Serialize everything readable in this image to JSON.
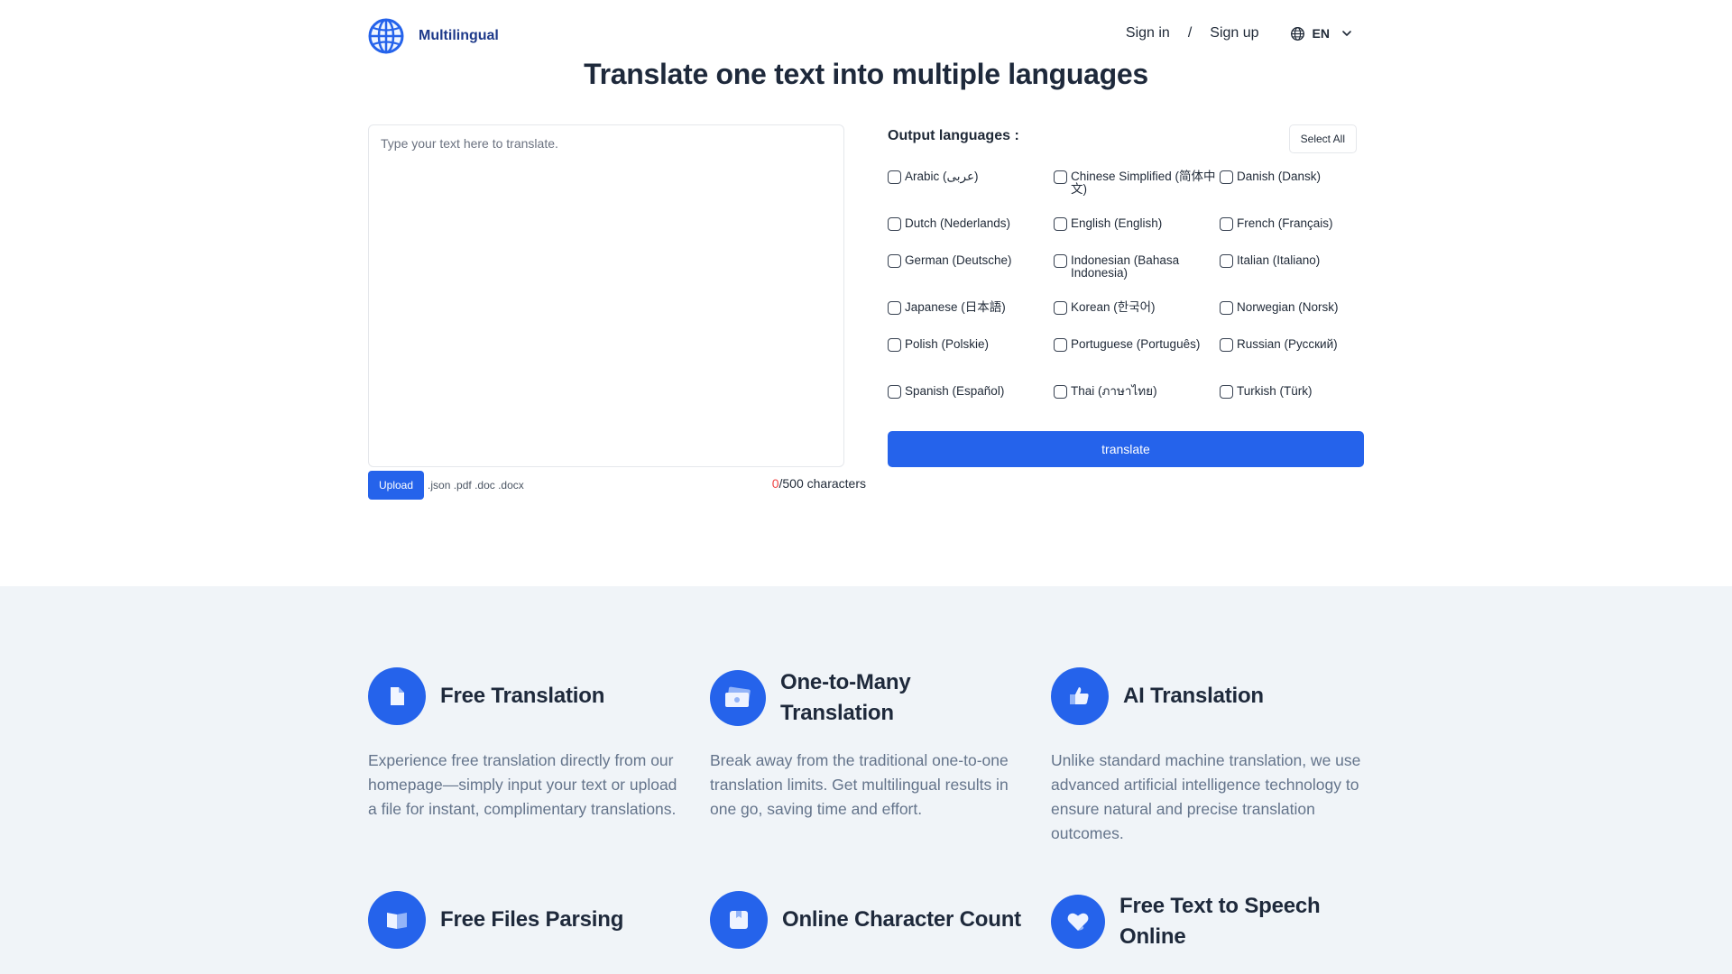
{
  "header": {
    "logo_text": "Multilingual",
    "sign_in": "Sign in",
    "separator": "/",
    "sign_up": "Sign up",
    "language": "EN"
  },
  "page_title": "Translate one text into multiple languages",
  "input": {
    "placeholder": "Type your text here to translate.",
    "value": ""
  },
  "upload": {
    "button_label": "Upload",
    "file_types": ".json .pdf .doc .docx"
  },
  "char_count": {
    "current": "0",
    "rest": "/500 characters"
  },
  "languages": {
    "title": "Output languages :",
    "select_all": "Select All",
    "items": [
      {
        "label": "Arabic (عربى)",
        "checked": false
      },
      {
        "label": "Chinese Simplified (简体中文)",
        "checked": false
      },
      {
        "label": "Danish (Dansk)",
        "checked": false
      },
      {
        "label": "Dutch (Nederlands)",
        "checked": false
      },
      {
        "label": "English (English)",
        "checked": false
      },
      {
        "label": "French (Français)",
        "checked": false
      },
      {
        "label": "German (Deutsche)",
        "checked": false
      },
      {
        "label": "Indonesian (Bahasa Indonesia)",
        "checked": false
      },
      {
        "label": "Italian (Italiano)",
        "checked": false
      },
      {
        "label": "Japanese (日本語)",
        "checked": false
      },
      {
        "label": "Korean (한국어)",
        "checked": false
      },
      {
        "label": "Norwegian (Norsk)",
        "checked": false
      },
      {
        "label": "Polish (Polskie)",
        "checked": false
      },
      {
        "label": "Portuguese (Português)",
        "checked": false
      },
      {
        "label": "Russian (Русский)",
        "checked": false
      },
      {
        "label": "Spanish (Español)",
        "checked": false
      },
      {
        "label": "Thai (ภาษาไทย)",
        "checked": false
      },
      {
        "label": "Turkish (Türk)",
        "checked": false
      }
    ]
  },
  "translate_button": "translate",
  "colors": {
    "primary": "#2563eb",
    "logo_text": "#1e3a8a",
    "count_highlight": "#ef4444",
    "features_bg": "#f0f4f8"
  },
  "features": [
    {
      "icon": "document-icon",
      "title": "Free Translation",
      "description": "Experience free translation directly from our homepage—simply input your text or upload a file for instant, complimentary translations."
    },
    {
      "icon": "banknotes-icon",
      "title": "One-to-Many Translation",
      "description": "Break away from the traditional one-to-one translation limits. Get multilingual results in one go, saving time and effort."
    },
    {
      "icon": "thumbs-up-icon",
      "title": "AI Translation",
      "description": "Unlike standard machine translation, we use advanced artificial intelligence technology to ensure natural and precise translation outcomes."
    },
    {
      "icon": "book-open-icon",
      "title": "Free Files Parsing",
      "description": ""
    },
    {
      "icon": "bookmark-icon",
      "title": "Online Character Count",
      "description": ""
    },
    {
      "icon": "heart-icon",
      "title": "Free Text to Speech Online",
      "description": ""
    }
  ]
}
